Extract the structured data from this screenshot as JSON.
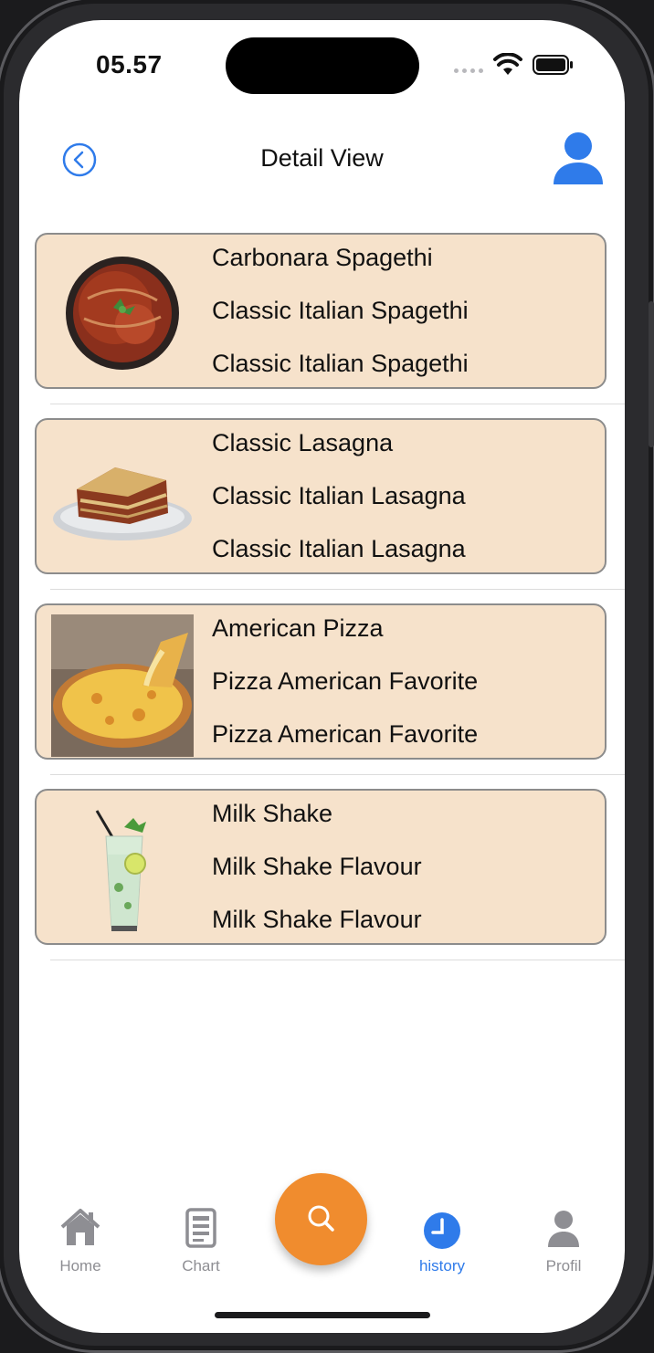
{
  "status_bar": {
    "time": "05.57"
  },
  "header": {
    "title": "Detail View"
  },
  "items": [
    {
      "title": "Carbonara Spagethi",
      "subtitle": "Classic Italian Spagethi",
      "description": "Classic Italian Spagethi",
      "image": "spaghetti-image"
    },
    {
      "title": "Classic Lasagna",
      "subtitle": "Classic Italian Lasagna",
      "description": "Classic Italian Lasagna",
      "image": "lasagna-image"
    },
    {
      "title": "American Pizza",
      "subtitle": "Pizza American Favorite",
      "description": "Pizza American Favorite",
      "image": "pizza-image"
    },
    {
      "title": "Milk Shake",
      "subtitle": "Milk Shake Flavour",
      "description": "Milk Shake Flavour",
      "image": "drink-image"
    }
  ],
  "tabbar": {
    "tabs": [
      {
        "label": "Home",
        "icon": "home-icon",
        "active": false
      },
      {
        "label": "Chart",
        "icon": "document-icon",
        "active": false
      },
      {
        "label": "history",
        "icon": "clock-icon",
        "active": true
      },
      {
        "label": "Profil",
        "icon": "person-icon",
        "active": false
      }
    ],
    "fab_icon": "search-icon"
  },
  "colors": {
    "accent": "#2f7bea",
    "fab": "#f08c2e",
    "card_bg": "#f6e2cb"
  }
}
